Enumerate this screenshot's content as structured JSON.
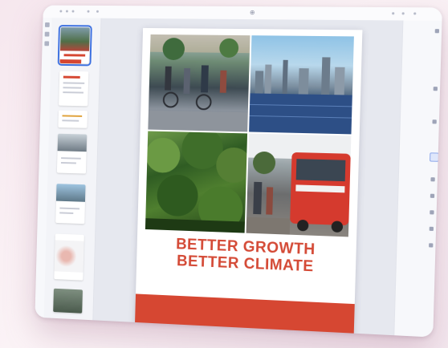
{
  "app": {
    "toolbar": {
      "icons": [
        "menu-icon",
        "undo-icon",
        "redo-icon",
        "zoom-icon",
        "more-icon"
      ],
      "zoom_glyph": "⊕"
    },
    "thumbnails": [
      {
        "kind": "cover",
        "active": true
      },
      {
        "kind": "text"
      },
      {
        "kind": "text"
      },
      {
        "kind": "photo-text"
      },
      {
        "kind": "photo-text"
      },
      {
        "kind": "map"
      },
      {
        "kind": "photo"
      }
    ]
  },
  "document": {
    "cover": {
      "title_line1": "BETTER GROWTH",
      "title_line2": "BETTER CLIMATE",
      "photos": [
        "street-photo",
        "city-skyline-photo",
        "forest-photo",
        "red-bus-photo"
      ]
    }
  },
  "colors": {
    "accent_red": "#d64732",
    "selection_blue": "#3b6fe0",
    "background_pink": "#f6e7ee"
  }
}
